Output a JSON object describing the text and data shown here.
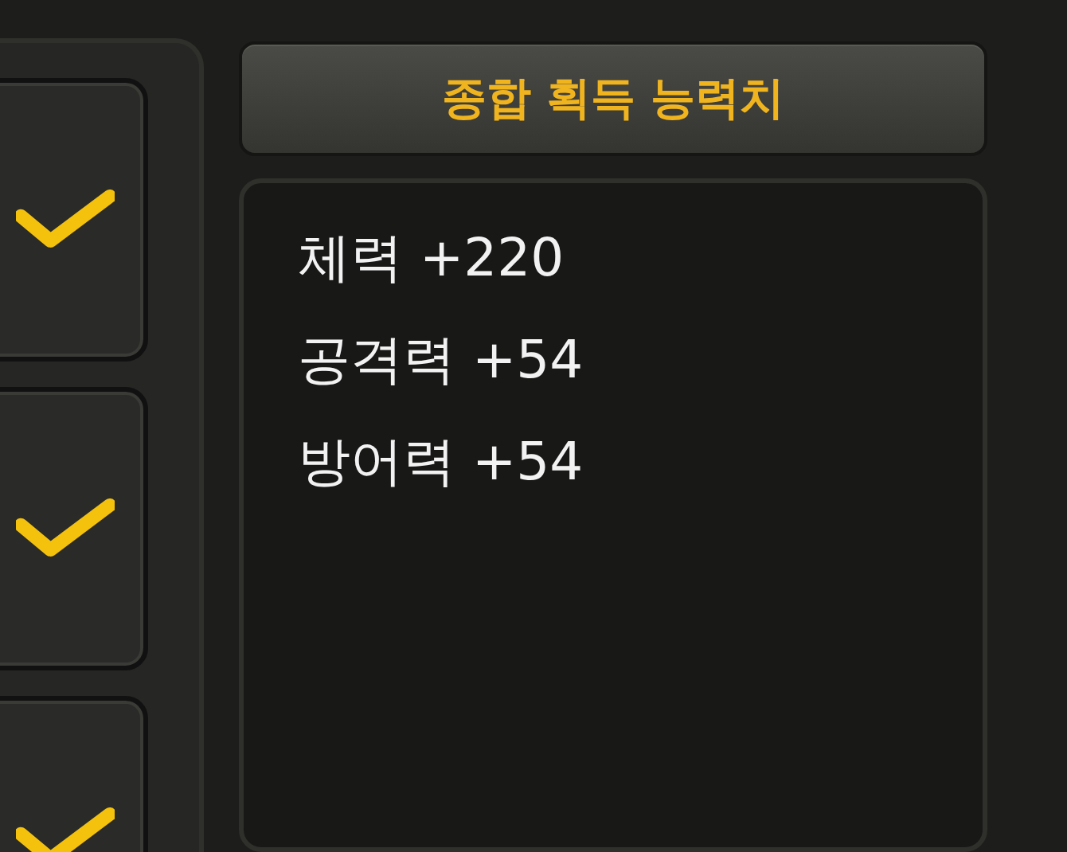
{
  "quest_slots": [
    {
      "checked": true
    },
    {
      "checked": true
    },
    {
      "checked": true
    }
  ],
  "stats_panel": {
    "title": "종합 획득 능력치",
    "stats": [
      "체력 +220",
      "공격력 +54",
      "방어력 +54"
    ]
  }
}
